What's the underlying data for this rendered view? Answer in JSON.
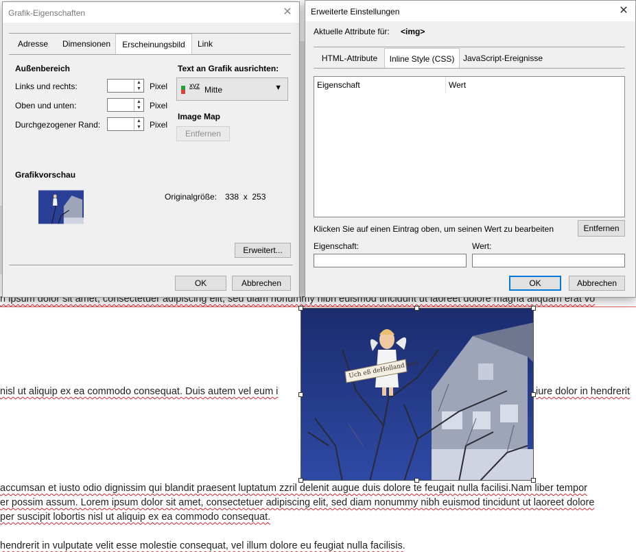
{
  "document": {
    "lines": [
      "n ipsum dolor sit amet, consectetuer adipiscing elit, sed diam nonummy nibh euismod tincidunt ut laoreet dolore magna aliquam erat vo",
      "nisl ut aliquip ex ea commodo consequat. Duis autem vel eum i",
      "iure dolor in hendrerit",
      "accumsan et iusto odio dignissim qui blandit praesent luptatum zzril delenit augue duis dolore te feugait nulla facilisi.Nam liber tempor",
      "er possim assum. Lorem ipsum dolor sit amet, consectetuer adipiscing elit, sed diam nonummy nibh euismod tincidunt ut laoreet dolore",
      "per suscipit lobortis nisl ut aliquip ex ea commodo consequat.",
      "hendrerit in vulputate velit esse molestie consequat, vel illum dolore eu feugiat nulla facilisis."
    ],
    "image_banner": "Uch eß deHolland verl"
  },
  "left_dialog": {
    "title": "Grafik-Eigenschaften",
    "close": "✕",
    "tabs": [
      "Adresse",
      "Dimensionen",
      "Erscheinungsbild",
      "Link"
    ],
    "active_tab": "Erscheinungsbild",
    "outer_section": "Außenbereich",
    "rows": [
      {
        "label": "Links und rechts:",
        "unit": "Pixel"
      },
      {
        "label": "Oben und unten:",
        "unit": "Pixel"
      },
      {
        "label": "Durchgezogener Rand:",
        "unit": "Pixel"
      }
    ],
    "align_heading": "Text an Grafik ausrichten:",
    "align_icon_text": "xyz",
    "align_value": "Mitte",
    "image_map_heading": "Image Map",
    "remove_button": "Entfernen",
    "preview_heading": "Grafikvorschau",
    "original_size_label": "Originalgröße:",
    "original_size_value": "338  x  253",
    "advanced_button": "Erweitert...",
    "ok_button": "OK",
    "cancel_button": "Abbrechen"
  },
  "right_dialog": {
    "title": "Erweiterte Einstellungen",
    "close": "✕",
    "attributes_for_label": "Aktuelle Attribute für:",
    "attributes_for_value": "<img>",
    "tabs": [
      "HTML-Attribute",
      "Inline Style (CSS)",
      "JavaScript-Ereignisse"
    ],
    "active_tab": "Inline Style (CSS)",
    "columns": [
      "Eigenschaft",
      "Wert"
    ],
    "hint": "Klicken Sie auf einen Eintrag oben, um seinen Wert zu bearbeiten",
    "remove_button": "Entfernen",
    "property_label": "Eigenschaft:",
    "value_label": "Wert:",
    "ok_button": "OK",
    "cancel_button": "Abbrechen"
  },
  "colors": {
    "accent": "#0078d7",
    "dialog_bg": "#f0f0f0",
    "spell_underline": "#dd2233"
  }
}
